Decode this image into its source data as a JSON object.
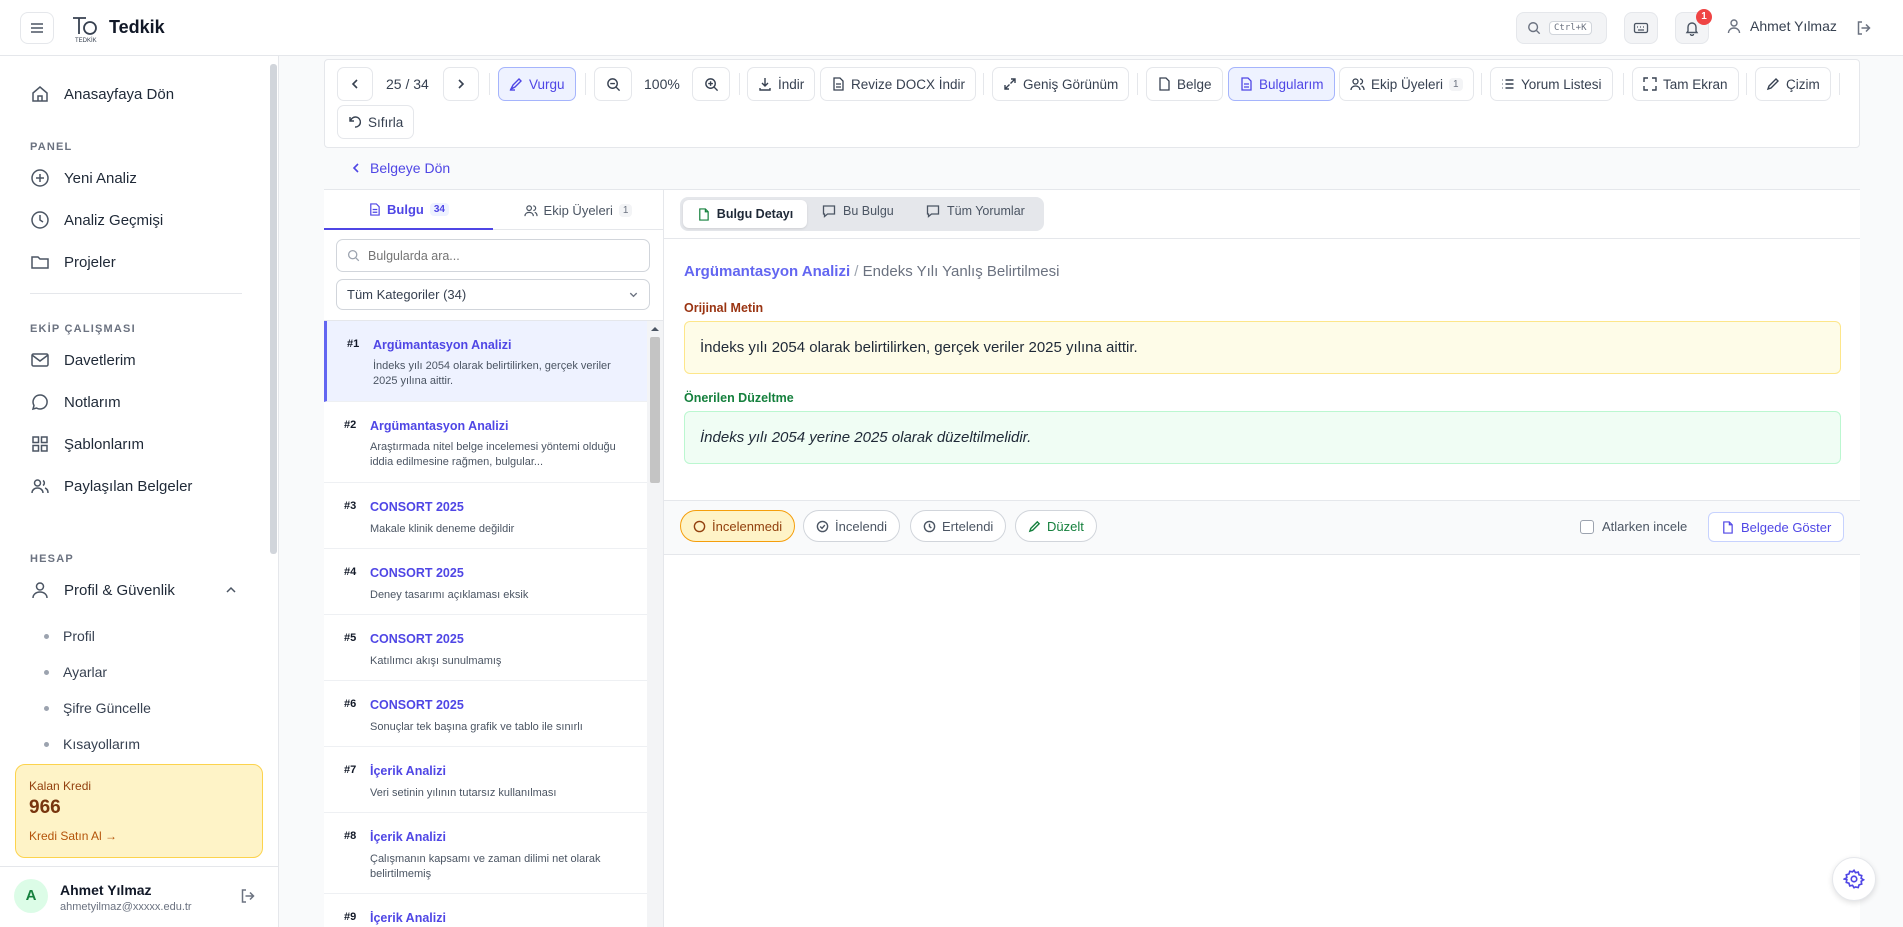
{
  "app": {
    "title": "Tedkik",
    "logo_text": "TEDKİK"
  },
  "header": {
    "shortcut": "Ctrl+K",
    "notif_count": "1",
    "user_name": "Ahmet Yılmaz"
  },
  "sidebar": {
    "home": "Anasayfaya Dön",
    "panel_heading": "PANEL",
    "panel_items": [
      "Yeni Analiz",
      "Analiz Geçmişi",
      "Projeler"
    ],
    "team_heading": "EKİP ÇALIŞMASI",
    "team_items": [
      "Davetlerim",
      "Notlarım",
      "Şablonlarım",
      "Paylaşılan Belgeler"
    ],
    "account_heading": "HESAP",
    "account_group": "Profil & Güvenlik",
    "account_subitems": [
      "Profil",
      "Ayarlar",
      "Şifre Güncelle",
      "Kısayollarım"
    ],
    "credit": {
      "label": "Kalan Kredi",
      "value": "966",
      "buy": "Kredi Satın Al →"
    },
    "user": {
      "initial": "A",
      "name": "Ahmet Yılmaz",
      "email": "ahmetyilmaz@xxxxx.edu.tr"
    }
  },
  "toolbar": {
    "page": "25 / 34",
    "highlight": "Vurgu",
    "zoom": "100%",
    "download": "İndir",
    "revise": "Revize DOCX İndir",
    "wide": "Geniş Görünüm",
    "document": "Belge",
    "findings": "Bulgularım",
    "team": "Ekip Üyeleri",
    "team_count": "1",
    "comments": "Yorum Listesi",
    "fullscreen": "Tam Ekran",
    "draw": "Çizim",
    "reset": "Sıfırla"
  },
  "back_link": "Belgeye Dön",
  "list_panel": {
    "tab_findings": "Bulgu",
    "tab_findings_count": "34",
    "tab_team": "Ekip Üyeleri",
    "tab_team_count": "1",
    "search_placeholder": "Bulgularda ara...",
    "category": "Tüm Kategoriler (34)",
    "items": [
      {
        "num": "#1",
        "title": "Argümantasyon Analizi",
        "desc": "İndeks yılı 2054 olarak belirtilirken, gerçek veriler 2025 yılına aittir."
      },
      {
        "num": "#2",
        "title": "Argümantasyon Analizi",
        "desc": "Araştırmada nitel belge incelemesi yöntemi olduğu iddia edilmesine rağmen, bulgular..."
      },
      {
        "num": "#3",
        "title": "CONSORT 2025",
        "desc": "Makale klinik deneme değildir"
      },
      {
        "num": "#4",
        "title": "CONSORT 2025",
        "desc": "Deney tasarımı açıklaması eksik"
      },
      {
        "num": "#5",
        "title": "CONSORT 2025",
        "desc": "Katılımcı akışı sunulmamış"
      },
      {
        "num": "#6",
        "title": "CONSORT 2025",
        "desc": "Sonuçlar tek başına grafik ve tablo ile sınırlı"
      },
      {
        "num": "#7",
        "title": "İçerik Analizi",
        "desc": "Veri setinin yılının tutarsız kullanılması"
      },
      {
        "num": "#8",
        "title": "İçerik Analizi",
        "desc": "Çalışmanın kapsamı ve zaman dilimi net olarak belirtilmemiş"
      },
      {
        "num": "#9",
        "title": "İçerik Analizi",
        "desc": ""
      }
    ]
  },
  "detail": {
    "tabs": [
      "Bulgu Detayı",
      "Bu Bulgu",
      "Tüm Yorumlar"
    ],
    "breadcrumb_category": "Argümantasyon Analizi",
    "breadcrumb_sep": " / ",
    "breadcrumb_title": "Endeks Yılı Yanlış Belirtilmesi",
    "original_label": "Orijinal Metin",
    "original_text": "İndeks yılı 2054 olarak belirtilirken, gerçek veriler 2025 yılına aittir.",
    "suggested_label": "Önerilen Düzeltme",
    "suggested_text": "İndeks yılı 2054 yerine 2025 olarak düzeltilmelidir.",
    "status": [
      "İncelenmedi",
      "İncelendi",
      "Ertelendi",
      "Düzelt"
    ],
    "skip_label": "Atlarken incele",
    "show_in_doc": "Belgede Göster"
  },
  "colors": {
    "accent": "#4f46e5",
    "original_bg": "#fefce8",
    "suggested_bg": "#f0fdf4",
    "credit_bg": "#fef3c7"
  }
}
